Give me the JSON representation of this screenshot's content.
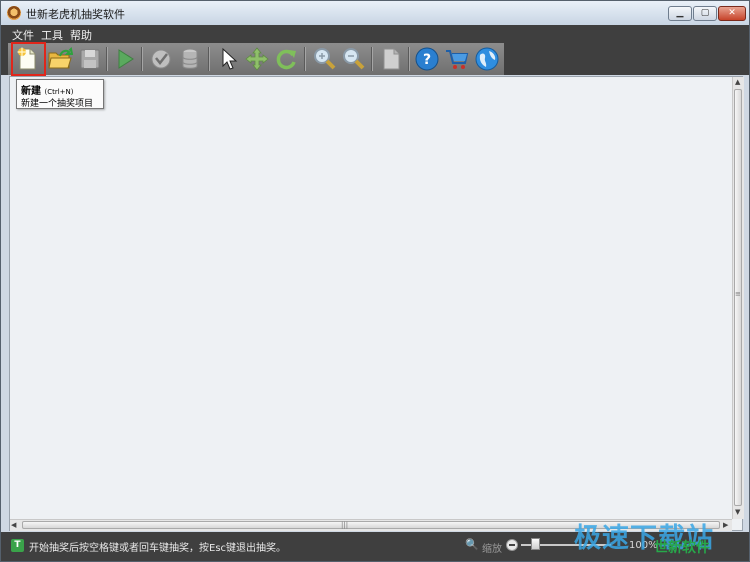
{
  "window": {
    "title": "世新老虎机抽奖软件"
  },
  "titlebar": {
    "minimize": "▁",
    "maximize": "▢",
    "close": "✕"
  },
  "menu": {
    "items": [
      "文件",
      "工具",
      "帮助"
    ]
  },
  "toolbar": {
    "buttons": [
      {
        "name": "new-icon"
      },
      {
        "name": "open-icon"
      },
      {
        "name": "save-icon"
      },
      {
        "name": "play-icon"
      },
      {
        "name": "check-icon"
      },
      {
        "name": "database-icon"
      },
      {
        "name": "pointer-icon"
      },
      {
        "name": "move-icon"
      },
      {
        "name": "rotate-icon"
      },
      {
        "name": "zoom-in-icon"
      },
      {
        "name": "zoom-out-icon"
      },
      {
        "name": "document-icon"
      },
      {
        "name": "help-icon"
      },
      {
        "name": "cart-icon"
      },
      {
        "name": "globe-icon"
      }
    ]
  },
  "tooltip": {
    "title": "新建",
    "shortcut": "(Ctrl+N)",
    "description": "新建一个抽奖项目"
  },
  "statusbar": {
    "icon": "T",
    "message": "开始抽奖后按空格键或者回车键抽奖，按Esc键退出抽奖。",
    "zoom_label": "缩放",
    "zoom_value": "100%",
    "zoom_level_percent": 12
  },
  "watermark": {
    "text": "极速下载站",
    "subtext": "世新软件"
  },
  "colors": {
    "chrome": "#3f3f3f",
    "canvas": "#eef1f4",
    "highlight": "#e0261b"
  }
}
